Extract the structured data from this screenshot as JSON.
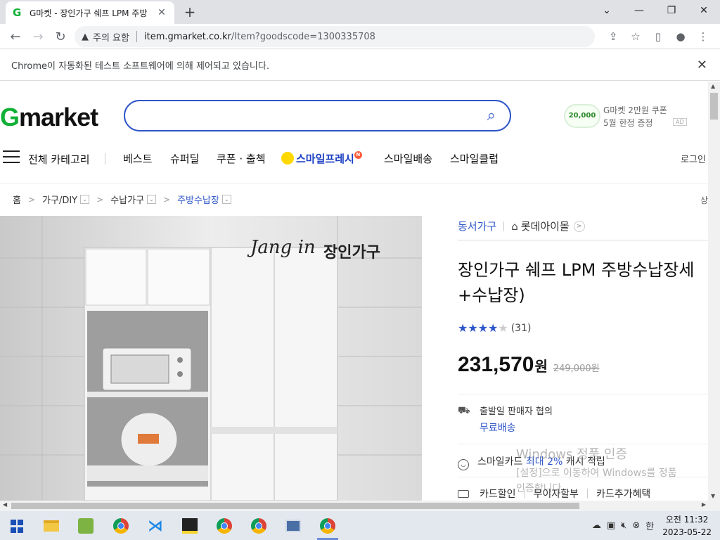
{
  "browser": {
    "tab_title": "G마켓 - 장인가구 쉐프 LPM 주방",
    "favicon_letter": "G",
    "new_tab": "+",
    "security_label": "주의 요함",
    "url_host": "item.gmarket.co.kr",
    "url_path": "/Item?goodscode=1300335708",
    "infobar_message": "Chrome이 자동화된 테스트 소프트웨어에 의해 제어되고 있습니다."
  },
  "header": {
    "logo_g": "G",
    "logo_rest": "market",
    "search_placeholder": "",
    "ad_coupon_amount": "20,000",
    "ad_line1": "G마켓 2만원 쿠폰",
    "ad_line2": "5월 한정 증정",
    "ad_tag": "AD"
  },
  "gnb": {
    "all_categories": "전체 카테고리",
    "menu": [
      "베스트",
      "슈퍼딜",
      "쿠폰 · 출첵"
    ],
    "smile_fresh": "스마일프레시",
    "smile_fresh_badge": "N",
    "menu2": [
      "스마일배송",
      "스마일클럽"
    ],
    "login": "로그인"
  },
  "breadcrumb": {
    "home": "홈",
    "items": [
      "가구/DIY",
      "수납가구",
      "주방수납장"
    ],
    "right_fragment": "상"
  },
  "product": {
    "image_brand_script": "Jang in",
    "image_brand_korean": "장인가구",
    "shop_name": "동서가구",
    "brand_name": "롯데아이몰",
    "title_line1": "장인가구 쉐프 LPM 주방수납장세",
    "title_line2": "+수납장)",
    "rating_value": 4,
    "rating_count": "(31)",
    "price": "231,570",
    "price_unit": "원",
    "original_price": "249,000원",
    "shipping_label": "출발일 판매자 협의",
    "shipping_fee": "무료배송",
    "smilecard_prefix": "스마일카드 ",
    "smilecard_highlight": "최대 2%",
    "smilecard_suffix": " 캐시 적립",
    "card_items": [
      "카드할인",
      "무이자할부",
      "카드추가혜택"
    ]
  },
  "watermark": {
    "line1": "Windows 정품 인증",
    "line2": "[설정]으로 이동하여 Windows를 정품",
    "line3": "인증합니다."
  },
  "taskbar": {
    "time": "오전 11:32",
    "date": "2023-05-22",
    "ime": "한"
  }
}
